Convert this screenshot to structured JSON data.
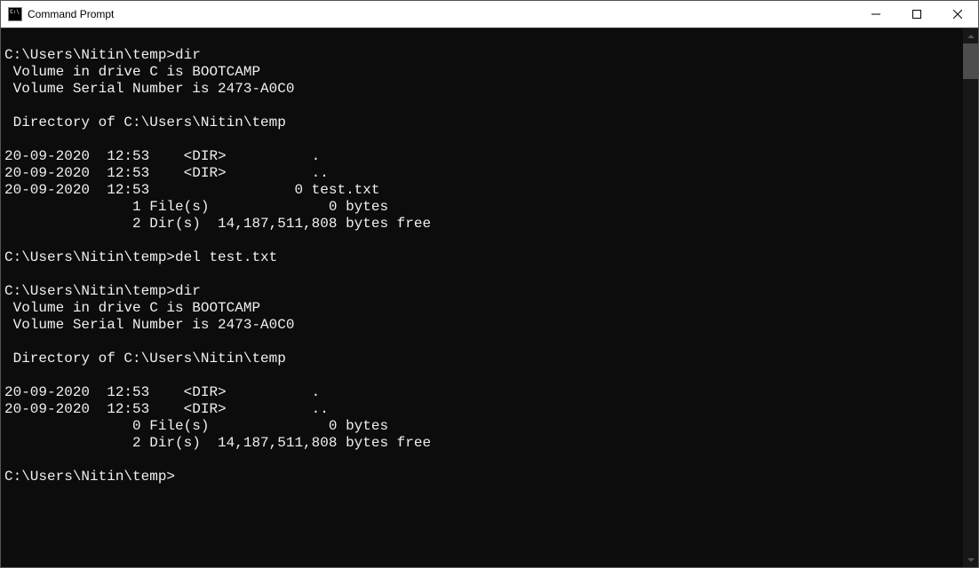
{
  "window": {
    "title": "Command Prompt"
  },
  "terminal": {
    "lines": [
      "",
      "C:\\Users\\Nitin\\temp>dir",
      " Volume in drive C is BOOTCAMP",
      " Volume Serial Number is 2473-A0C0",
      "",
      " Directory of C:\\Users\\Nitin\\temp",
      "",
      "20-09-2020  12:53    <DIR>          .",
      "20-09-2020  12:53    <DIR>          ..",
      "20-09-2020  12:53                 0 test.txt",
      "               1 File(s)              0 bytes",
      "               2 Dir(s)  14,187,511,808 bytes free",
      "",
      "C:\\Users\\Nitin\\temp>del test.txt",
      "",
      "C:\\Users\\Nitin\\temp>dir",
      " Volume in drive C is BOOTCAMP",
      " Volume Serial Number is 2473-A0C0",
      "",
      " Directory of C:\\Users\\Nitin\\temp",
      "",
      "20-09-2020  12:53    <DIR>          .",
      "20-09-2020  12:53    <DIR>          ..",
      "               0 File(s)              0 bytes",
      "               2 Dir(s)  14,187,511,808 bytes free",
      "",
      "C:\\Users\\Nitin\\temp>"
    ]
  }
}
